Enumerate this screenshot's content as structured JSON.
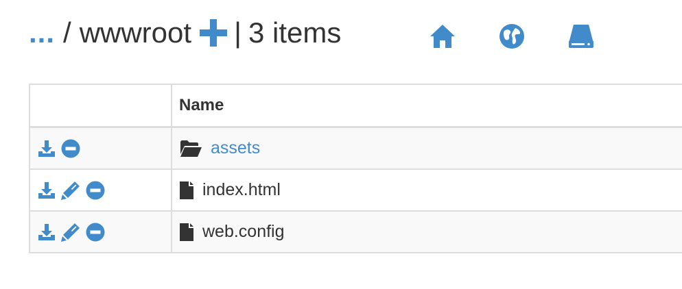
{
  "breadcrumb": {
    "parent_link": "...",
    "separator": "/",
    "current": "wwwroot",
    "pipe": "|",
    "item_count": "3 items"
  },
  "header_icons": [
    "plus-icon",
    "home-icon",
    "globe-icon",
    "hdd-icon"
  ],
  "table": {
    "columns": [
      "",
      "Name"
    ],
    "rows": [
      {
        "type": "folder",
        "name": "assets",
        "actions": [
          "download",
          "delete"
        ]
      },
      {
        "type": "file",
        "name": "index.html",
        "actions": [
          "download",
          "edit",
          "delete"
        ]
      },
      {
        "type": "file",
        "name": "web.config",
        "actions": [
          "download",
          "edit",
          "delete"
        ]
      }
    ]
  },
  "colors": {
    "accent": "#428bca",
    "text": "#333333",
    "border": "#dddddd",
    "stripe": "#f9f9f9"
  }
}
